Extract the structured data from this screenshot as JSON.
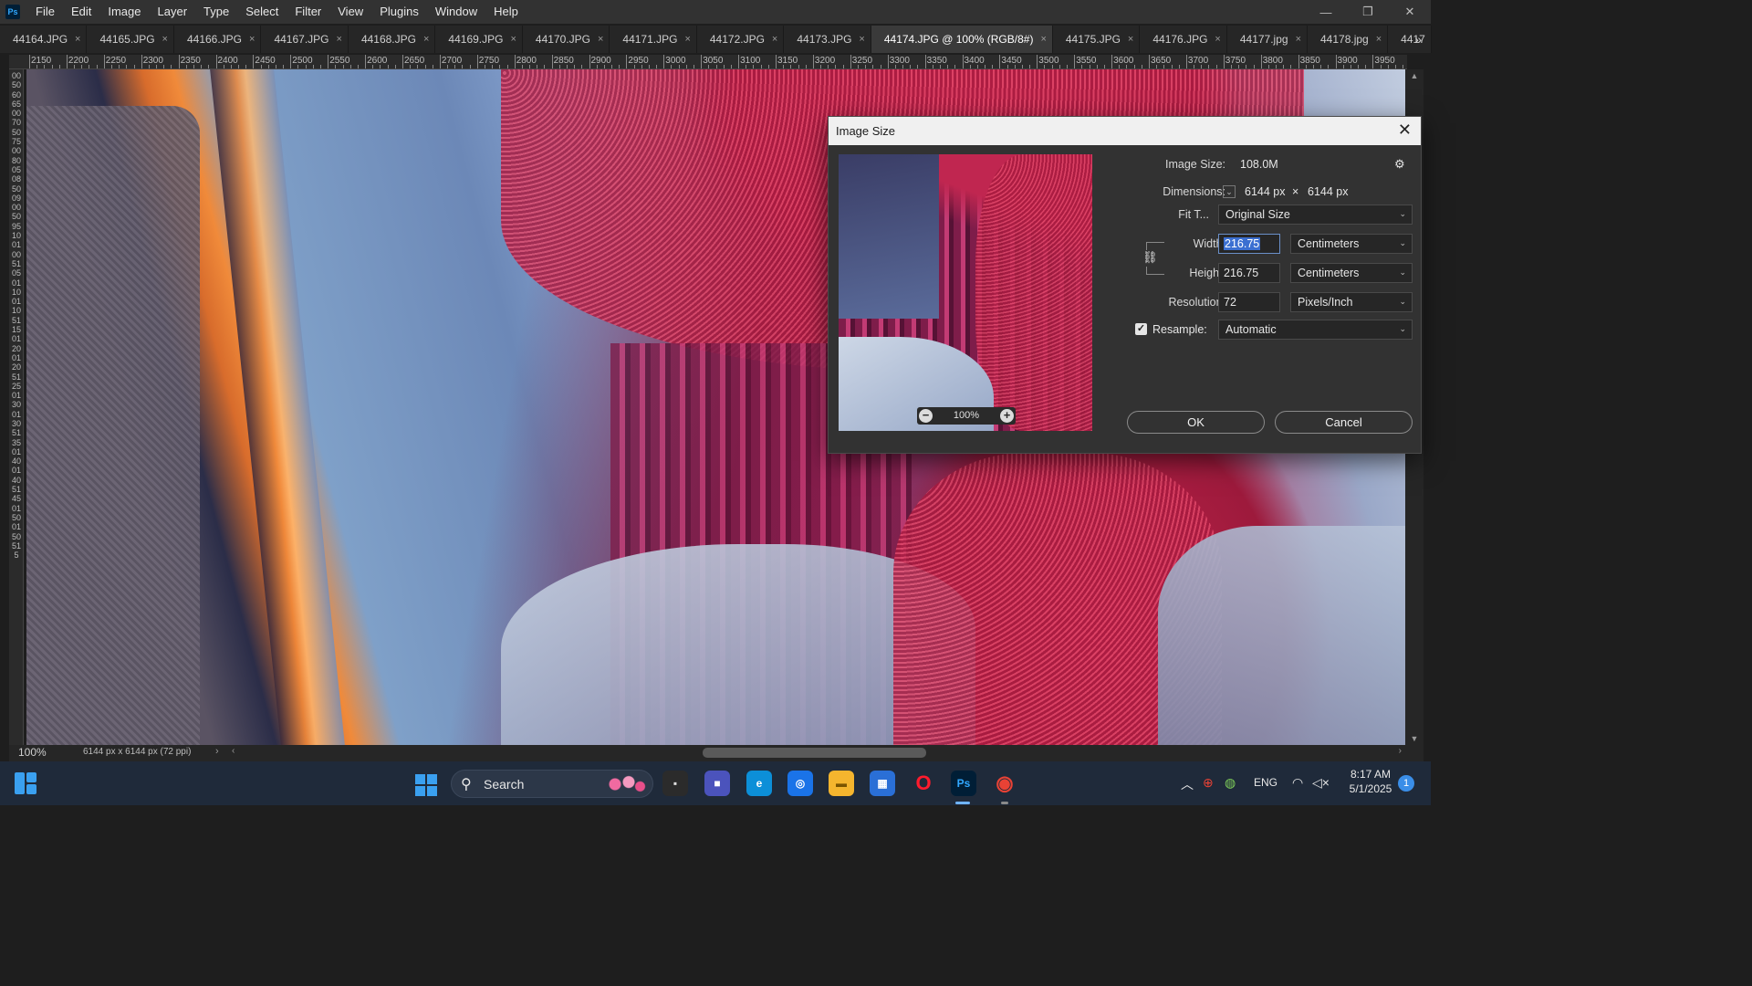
{
  "app": {
    "logo_text": "Ps",
    "menu": [
      "File",
      "Edit",
      "Image",
      "Layer",
      "Type",
      "Select",
      "Filter",
      "View",
      "Plugins",
      "Window",
      "Help"
    ]
  },
  "tabs": [
    {
      "label": "44164.JPG",
      "active": false
    },
    {
      "label": "44165.JPG",
      "active": false
    },
    {
      "label": "44166.JPG",
      "active": false
    },
    {
      "label": "44167.JPG",
      "active": false
    },
    {
      "label": "44168.JPG",
      "active": false
    },
    {
      "label": "44169.JPG",
      "active": false
    },
    {
      "label": "44170.JPG",
      "active": false
    },
    {
      "label": "44171.JPG",
      "active": false
    },
    {
      "label": "44172.JPG",
      "active": false
    },
    {
      "label": "44173.JPG",
      "active": false
    },
    {
      "label": "44174.JPG @ 100% (RGB/8#)",
      "active": true
    },
    {
      "label": "44175.JPG",
      "active": false
    },
    {
      "label": "44176.JPG",
      "active": false
    },
    {
      "label": "44177.jpg",
      "active": false
    },
    {
      "label": "44178.jpg",
      "active": false
    },
    {
      "label": "4417",
      "active": false
    }
  ],
  "tab_close_glyph": "×",
  "tab_overflow_glyph": "»",
  "ruler": {
    "top_labels": [
      "2150",
      "2200",
      "2250",
      "2300",
      "2350",
      "2400",
      "2450",
      "2500",
      "2550",
      "2600",
      "2650",
      "2700",
      "2750",
      "2800",
      "2850",
      "2900",
      "2950",
      "3000",
      "3050",
      "3100",
      "3150",
      "3200",
      "3250",
      "3300",
      "3350",
      "3400",
      "3450",
      "3500",
      "3550",
      "3600",
      "3650",
      "3700",
      "3750",
      "3800",
      "3850",
      "3900",
      "3950"
    ],
    "left_digits": "0050606500705075008005085009005095100100510501100110511501200120512501300130513501400140514501500150515"
  },
  "status": {
    "zoom": "100%",
    "doc_info": "6144 px x 6144 px (72 ppi)",
    "arrow": "›"
  },
  "dialog": {
    "title": "Image Size",
    "close_glyph": "✕",
    "preview_zoom": "100%",
    "image_size_label": "Image Size:",
    "image_size_value": "108.0M",
    "gear_glyph": "⚙",
    "dimensions_label": "Dimensions:",
    "dimensions_width": "6144 px",
    "dimensions_times": "×",
    "dimensions_height": "6144 px",
    "fit_label": "Fit T...",
    "fit_value": "Original Size",
    "width_label": "Width:",
    "width_value": "216.75",
    "width_unit": "Centimeters",
    "height_label": "Height:",
    "height_value": "216.75",
    "height_unit": "Centimeters",
    "resolution_label": "Resolution:",
    "resolution_value": "72",
    "resolution_unit": "Pixels/Inch",
    "resample_label": "Resample:",
    "resample_checked": true,
    "resample_value": "Automatic",
    "ok_label": "OK",
    "cancel_label": "Cancel"
  },
  "window_controls": {
    "minimize": "—",
    "restore": "❐",
    "close": "✕"
  },
  "taskbar": {
    "search_placeholder": "Search",
    "lang": "ENG",
    "time": "8:17 AM",
    "date": "5/1/2025",
    "notification_count": "1",
    "apps": [
      {
        "name": "task-view",
        "glyph": "▪",
        "color": "#2b2b2b",
        "fg": "#e0e0e0"
      },
      {
        "name": "meet",
        "glyph": "■",
        "color": "#4b53bc",
        "fg": "#ffffff"
      },
      {
        "name": "edge",
        "glyph": "e",
        "color": "#0c8fd8",
        "fg": "#ffffff"
      },
      {
        "name": "lens",
        "glyph": "◎",
        "color": "#1a73e8",
        "fg": "#ffffff"
      },
      {
        "name": "explorer",
        "glyph": "▬",
        "color": "#f5b52e",
        "fg": "#7a5400"
      },
      {
        "name": "store",
        "glyph": "▦",
        "color": "#2a6fd6",
        "fg": "#ffffff"
      },
      {
        "name": "opera",
        "glyph": "O",
        "color": "transparent",
        "fg": "#ff1b2d"
      },
      {
        "name": "photoshop",
        "glyph": "Ps",
        "color": "#001e36",
        "fg": "#31a8ff"
      },
      {
        "name": "chrome",
        "glyph": "◉",
        "color": "transparent",
        "fg": "#e94235"
      }
    ]
  }
}
